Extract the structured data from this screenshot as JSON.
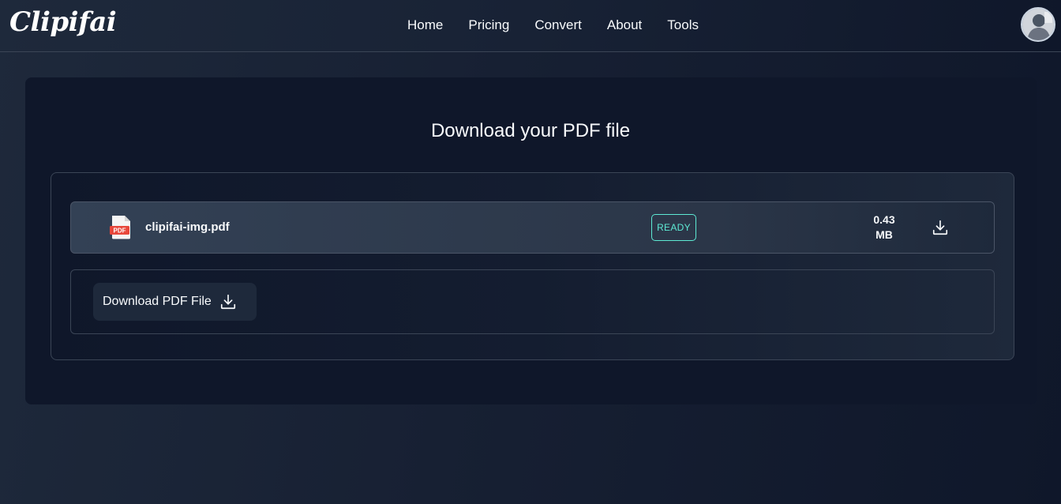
{
  "header": {
    "logo": "Clipifai",
    "nav": [
      "Home",
      "Pricing",
      "Convert",
      "About",
      "Tools"
    ]
  },
  "main": {
    "title": "Download your PDF file",
    "file": {
      "icon_label": "PDF",
      "name": "clipifai-img.pdf",
      "status": "READY",
      "size_value": "0.43",
      "size_unit": "MB"
    },
    "download_button": "Download PDF File"
  },
  "colors": {
    "background": "#0f172a",
    "status_accent": "#5eead4",
    "pdf_red": "#e8473b"
  },
  "icons": [
    "pdf-file-icon",
    "download-icon",
    "avatar"
  ]
}
